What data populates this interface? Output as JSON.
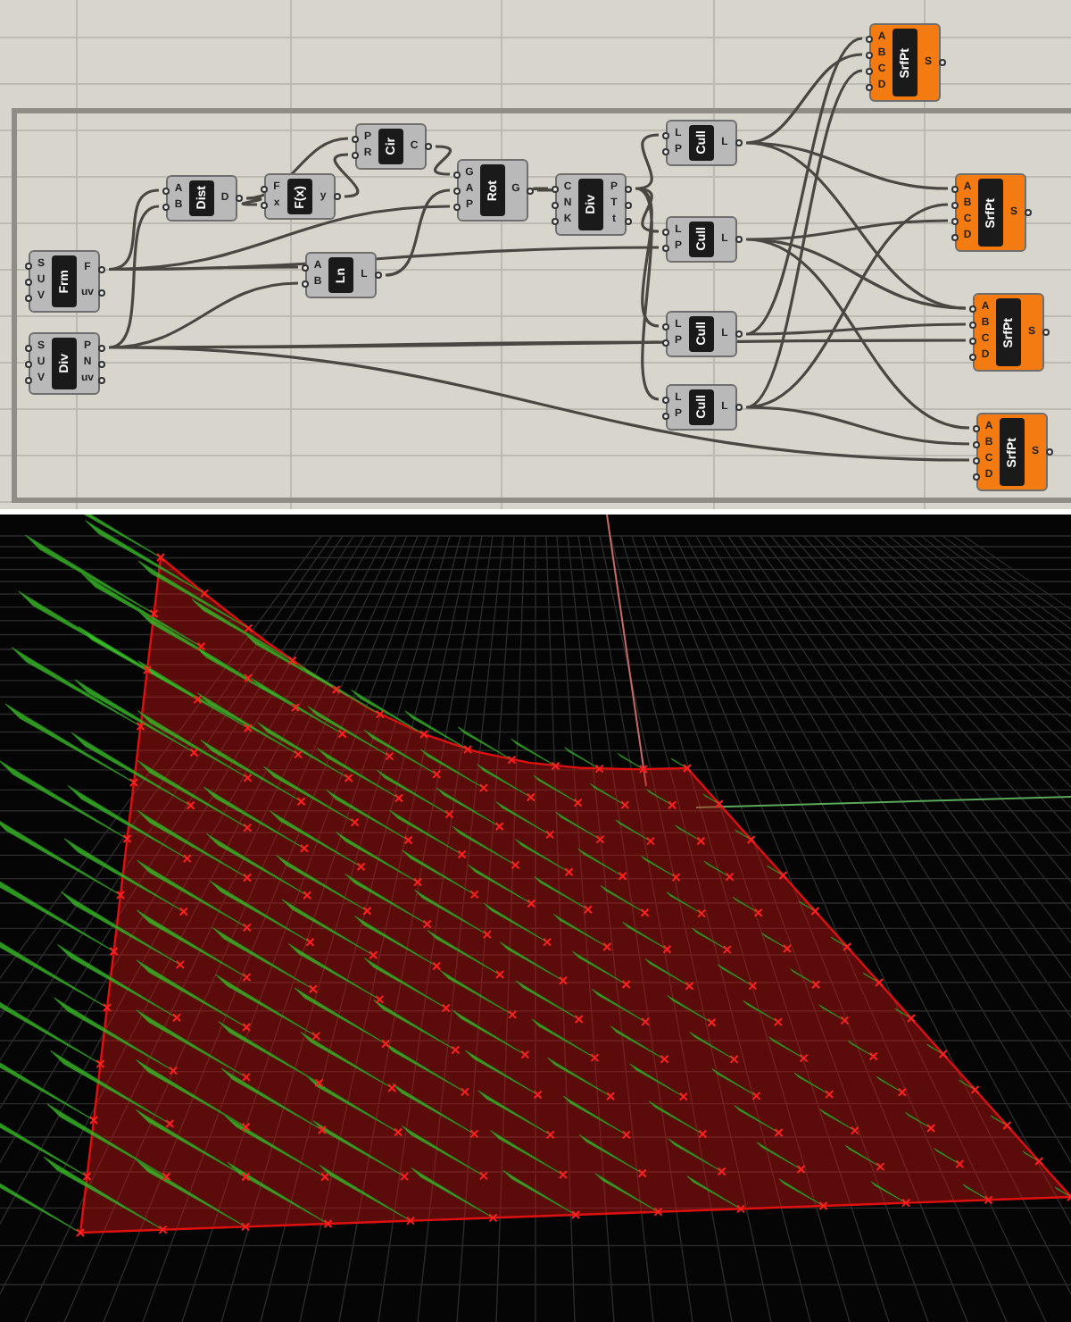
{
  "canvas": {
    "nodes": [
      {
        "label": "Frm",
        "inputs": [
          "S",
          "U",
          "V"
        ],
        "outputs": [
          "F",
          "uv"
        ],
        "color": "#b9b9b9"
      },
      {
        "label": "Div",
        "inputs": [
          "S",
          "U",
          "V"
        ],
        "outputs": [
          "P",
          "N",
          "uv"
        ],
        "color": "#b9b9b9"
      },
      {
        "label": "Dist",
        "inputs": [
          "A",
          "B"
        ],
        "outputs": [
          "D"
        ],
        "color": "#b9b9b9"
      },
      {
        "label": "F(x)",
        "inputs": [
          "F",
          "x"
        ],
        "outputs": [
          "y"
        ],
        "color": "#b9b9b9"
      },
      {
        "label": "Cir",
        "inputs": [
          "P",
          "R"
        ],
        "outputs": [
          "C"
        ],
        "color": "#b9b9b9"
      },
      {
        "label": "Rot",
        "inputs": [
          "G",
          "A",
          "P"
        ],
        "outputs": [
          "G"
        ],
        "color": "#b9b9b9"
      },
      {
        "label": "Ln",
        "inputs": [
          "A",
          "B"
        ],
        "outputs": [
          "L"
        ],
        "color": "#b9b9b9"
      },
      {
        "label": "Div",
        "inputs": [
          "C",
          "N",
          "K"
        ],
        "outputs": [
          "P",
          "T",
          "t"
        ],
        "color": "#b9b9b9"
      },
      {
        "label": "Cull",
        "inputs": [
          "L",
          "P"
        ],
        "outputs": [
          "L"
        ],
        "color": "#b9b9b9"
      },
      {
        "label": "Cull",
        "inputs": [
          "L",
          "P"
        ],
        "outputs": [
          "L"
        ],
        "color": "#b9b9b9"
      },
      {
        "label": "Cull",
        "inputs": [
          "L",
          "P"
        ],
        "outputs": [
          "L"
        ],
        "color": "#b9b9b9"
      },
      {
        "label": "Cull",
        "inputs": [
          "L",
          "P"
        ],
        "outputs": [
          "L"
        ],
        "color": "#b9b9b9"
      },
      {
        "label": "SrfPt",
        "inputs": [
          "A",
          "B",
          "C",
          "D"
        ],
        "outputs": [
          "S"
        ],
        "color": "#f47b12"
      },
      {
        "label": "SrfPt",
        "inputs": [
          "A",
          "B",
          "C",
          "D"
        ],
        "outputs": [
          "S"
        ],
        "color": "#f47b12"
      },
      {
        "label": "SrfPt",
        "inputs": [
          "A",
          "B",
          "C",
          "D"
        ],
        "outputs": [
          "S"
        ],
        "color": "#f47b12"
      },
      {
        "label": "SrfPt",
        "inputs": [
          "A",
          "B",
          "C",
          "D"
        ],
        "outputs": [
          "S"
        ],
        "color": "#f47b12"
      }
    ]
  }
}
